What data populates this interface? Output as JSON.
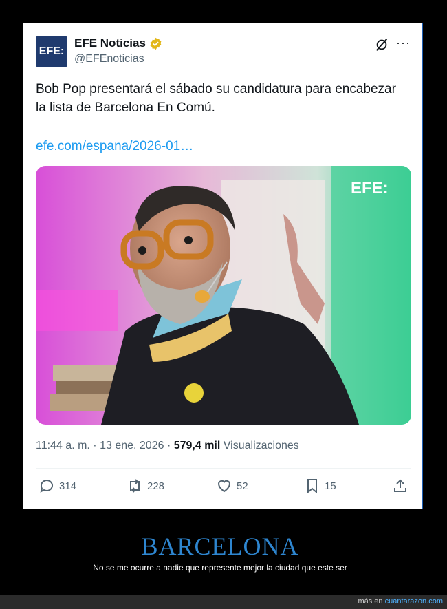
{
  "tweet": {
    "avatar_text": "EFE:",
    "display_name": "EFE Noticias",
    "handle": "@EFEnoticias",
    "text": "Bob Pop presentará el sábado su candidatura para encabezar la lista de Barcelona En Comú.",
    "link": "efe.com/espana/2026-01…",
    "image_watermark": "EFE:",
    "time": "11:44 a. m. · 13 ene. 2026 · ",
    "views_count": "579,4 mil",
    "views_label": " Visualizaciones",
    "replies": "314",
    "reposts": "228",
    "likes": "52",
    "bookmarks": "15",
    "verified_color": "#e2b719",
    "link_color": "#1d9bf0"
  },
  "caption": {
    "title": "BARCELONA",
    "subtitle": "No se me ocurre a nadie que represente mejor la ciudad que este ser"
  },
  "footer": {
    "prefix": "más en ",
    "site": "cuantarazon.com"
  }
}
